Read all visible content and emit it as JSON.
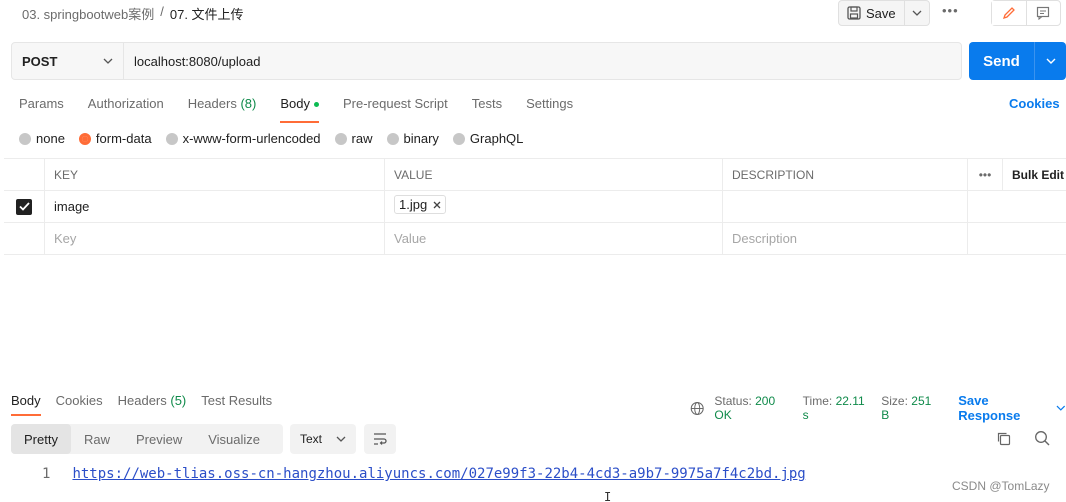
{
  "breadcrumb": {
    "parent": "03. springbootweb案例",
    "separator": "/",
    "current": "07. 文件上传"
  },
  "toolbar": {
    "save_label": "Save",
    "more": "•••"
  },
  "request": {
    "method": "POST",
    "url": "localhost:8080/upload",
    "send_label": "Send"
  },
  "request_tabs": {
    "params": "Params",
    "authorization": "Authorization",
    "headers": "Headers",
    "headers_count": "(8)",
    "body": "Body",
    "prerequest": "Pre-request Script",
    "tests": "Tests",
    "settings": "Settings",
    "cookies": "Cookies"
  },
  "body_types": [
    "none",
    "form-data",
    "x-www-form-urlencoded",
    "raw",
    "binary",
    "GraphQL"
  ],
  "body_type_selected": "form-data",
  "form_table": {
    "headers": {
      "key": "KEY",
      "value": "VALUE",
      "description": "DESCRIPTION",
      "more": "•••",
      "bulk_edit": "Bulk Edit"
    },
    "rows": [
      {
        "checked": true,
        "key": "image",
        "value": "1.jpg",
        "description": ""
      }
    ],
    "placeholders": {
      "key": "Key",
      "value": "Value",
      "description": "Description"
    }
  },
  "response_tabs": {
    "body": "Body",
    "cookies": "Cookies",
    "headers": "Headers",
    "headers_count": "(5)",
    "test_results": "Test Results"
  },
  "response_meta": {
    "status_label": "Status:",
    "status_value": "200 OK",
    "time_label": "Time:",
    "time_value": "22.11 s",
    "size_label": "Size:",
    "size_value": "251 B",
    "save_response": "Save Response"
  },
  "view_modes": {
    "pretty": "Pretty",
    "raw": "Raw",
    "preview": "Preview",
    "visualize": "Visualize",
    "format": "Text"
  },
  "response_body": {
    "line_no": "1",
    "text": "https://web-tlias.oss-cn-hangzhou.aliyuncs.com/027e99f3-22b4-4cd3-a9b7-9975a7f4c2bd.jpg"
  },
  "watermark": "CSDN @TomLazy",
  "colors": {
    "accent": "#ff6c37",
    "primary": "#097bed",
    "success": "#0f8a4a"
  }
}
